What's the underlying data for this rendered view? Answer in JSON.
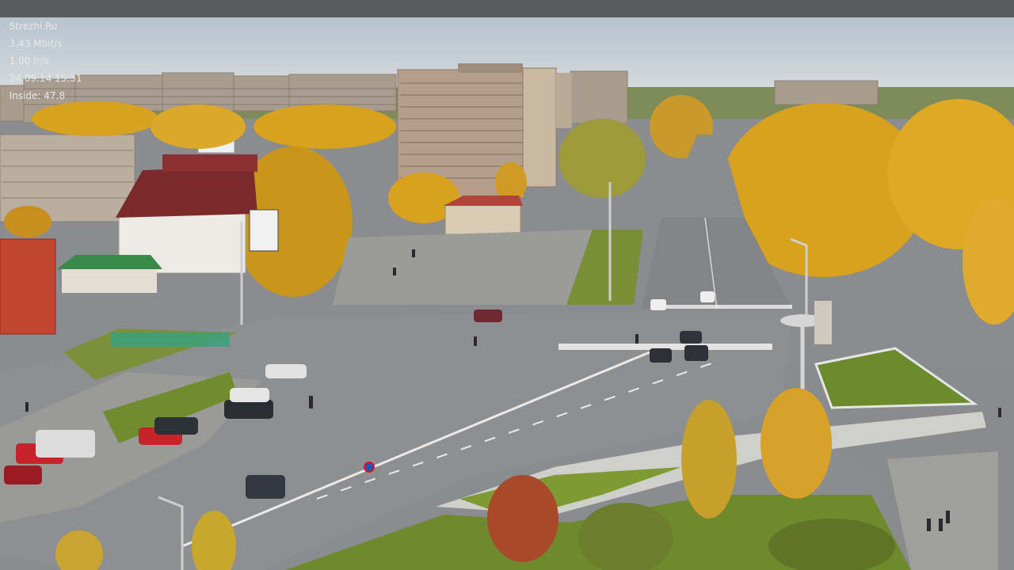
{
  "overlay": {
    "site": "Strezhi.Ru",
    "bitrate": "3.43 Mbit/s",
    "framerate": "1.00 fr/s",
    "datetime": "24.09.14 15:31",
    "inside": "Inside: 47.8"
  },
  "colors": {
    "overlay_bar": "#5a5c5f",
    "overlay_text": "#e8e8e8",
    "sky": "#c9d2d9",
    "foliage_yellow": "#d8a21f",
    "foliage_orange": "#c9861a",
    "asphalt": "#8e8f91",
    "grass": "#6f8a2c",
    "building_gray": "#b6aca0",
    "building_red": "#c2452f",
    "roof_maroon": "#7a2a2a",
    "roof_blue": "#2f5d9a",
    "roof_green": "#3a8a4a"
  }
}
